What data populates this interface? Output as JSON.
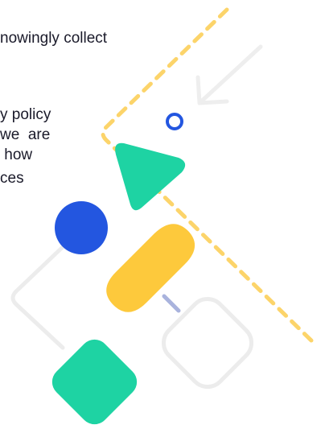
{
  "paragraph": {
    "lines": [
      "nowingly collect",
      "y policy",
      "we  are",
      " how",
      "ces"
    ]
  },
  "colors": {
    "dashed_line": "#fcd46a",
    "outline_light": "#ececec",
    "green_triangle": "#1ed3a3",
    "green_diamond": "#1ed3a3",
    "blue_circle": "#2356e0",
    "blue_ring": "#2356e0",
    "yellow_pill": "#fdc93c",
    "blue_dash": "#a9b3dd",
    "arrow": "#eeeeee"
  },
  "icons": {
    "arrow": "arrow-down-left-icon",
    "ring": "ring-outline-icon",
    "triangle": "triangle-shape",
    "circle": "circle-shape",
    "pill": "pill-shape",
    "diamond": "rounded-diamond-shape"
  }
}
